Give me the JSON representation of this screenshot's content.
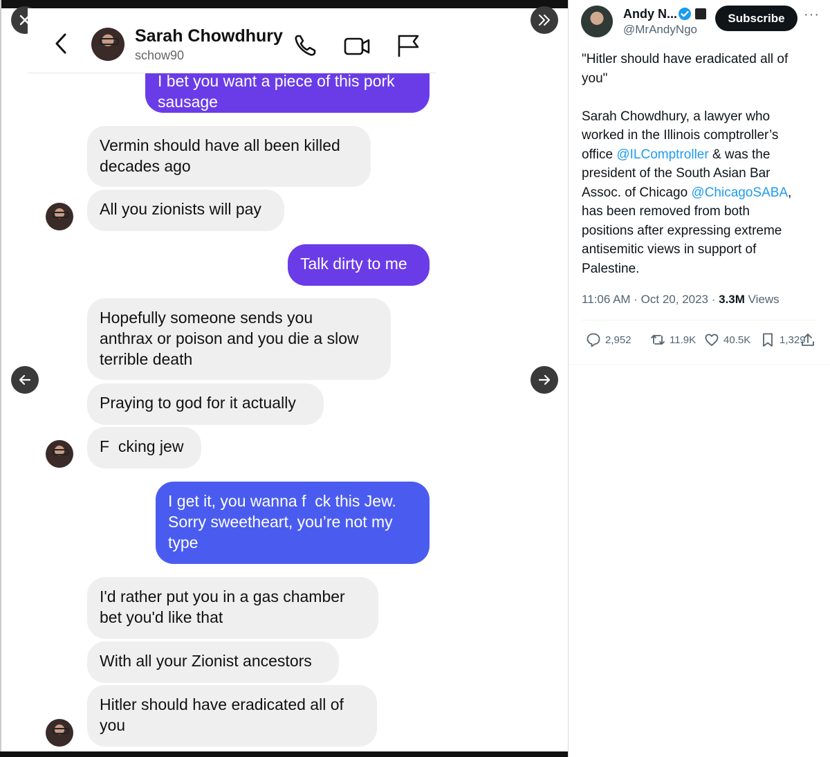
{
  "viewer": {
    "close_icon": "close-icon",
    "collapse_icon": "double-chevron-right-icon",
    "prev_icon": "arrow-left-icon",
    "next_icon": "arrow-right-icon"
  },
  "chat": {
    "contact_name": "Sarah Chowdhury",
    "contact_handle": "schow90",
    "header_icons": [
      "chevron-left-icon",
      "phone-icon",
      "video-icon",
      "flag-icon"
    ],
    "messages": [
      {
        "direction": "outgoing",
        "lines": [
          "I bet you want a piece of this pork",
          "sausage"
        ]
      },
      {
        "direction": "incoming",
        "lines": [
          "Vermin should have all been killed",
          "decades ago"
        ]
      },
      {
        "direction": "incoming",
        "lines": [
          "All you zionists will pay"
        ]
      },
      {
        "direction": "outgoing",
        "lines": [
          "Talk dirty to me"
        ]
      },
      {
        "direction": "incoming",
        "lines": [
          "Hopefully someone sends you",
          "anthrax or poison and you die a slow",
          "terrible death"
        ]
      },
      {
        "direction": "incoming",
        "lines": [
          "Praying to god for it actually"
        ]
      },
      {
        "direction": "incoming",
        "lines": [
          "F  cking jew"
        ]
      },
      {
        "direction": "outgoing",
        "lines": [
          "I get it, you wanna f  ck this Jew.",
          "Sorry sweetheart, you’re not my",
          "type"
        ]
      },
      {
        "direction": "incoming",
        "lines": [
          "I'd rather put you in a gas chamber",
          "bet you'd like that"
        ]
      },
      {
        "direction": "incoming",
        "lines": [
          "With all your Zionist ancestors"
        ]
      },
      {
        "direction": "incoming",
        "lines": [
          "Hitler should have eradicated all of",
          "you"
        ]
      }
    ]
  },
  "post": {
    "author_name": "Andy N...",
    "author_handle": "@MrAndyNgo",
    "subscribe_label": "Subscribe",
    "more_label": "···",
    "text": {
      "quote_l1": "\"Hitler should have eradicated all of",
      "quote_l2": "you\"",
      "p_l1": "Sarah Chowdhury, a lawyer who",
      "p_l2": "worked in the Illinois comptroller’s",
      "p_l3_a": "office ",
      "mention1": "@ILComptroller",
      "p_l3_b": " & was the",
      "p_l4": "president of the South Asian Bar",
      "p_l5_a": "Assoc. of Chicago ",
      "mention2": "@ChicagoSABA",
      "p_l5_b": ",",
      "p_l6": "has been removed from both",
      "p_l7": "positions after expressing extreme",
      "p_l8": "antisemitic views in support of",
      "p_l9": "Palestine."
    },
    "time": "11:06 AM · Oct 20, 2023 · ",
    "views_count": "3.3M",
    "views_label": " Views",
    "stats": {
      "replies": "2,952",
      "reposts": "11.9K",
      "likes": "40.5K",
      "bookmarks": "1,329"
    },
    "colors": {
      "link": "#1d9bf0",
      "subscribe_bg": "#0f1419",
      "verified": "#1d9bf0"
    }
  }
}
